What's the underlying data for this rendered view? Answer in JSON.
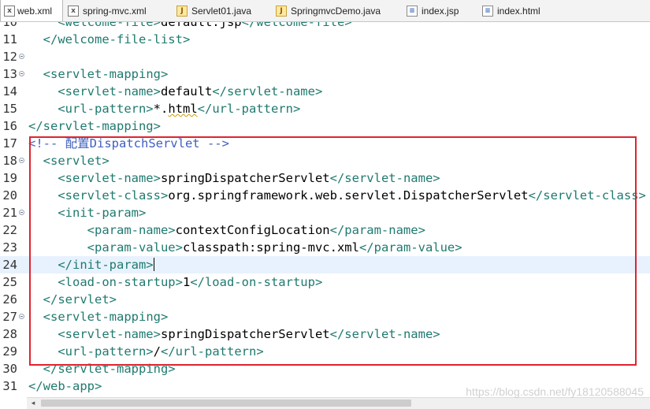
{
  "tabs": [
    {
      "label": "web.xml",
      "icon": "xml-file-icon",
      "active": true
    },
    {
      "label": "spring-mvc.xml",
      "icon": "xml-file-icon",
      "active": false
    },
    {
      "label": "Servlet01.java",
      "icon": "java-file-icon",
      "active": false
    },
    {
      "label": "SpringmvcDemo.java",
      "icon": "java-file-icon",
      "active": false
    },
    {
      "label": "index.jsp",
      "icon": "jsp-file-icon",
      "active": false
    },
    {
      "label": "index.html",
      "icon": "html-file-icon",
      "active": false
    }
  ],
  "editor": {
    "lines": [
      {
        "num": "10",
        "fold": false,
        "code": "    <welcome-file>default.jsp</welcome-file>"
      },
      {
        "num": "11",
        "fold": false,
        "code": "  </welcome-file-list>"
      },
      {
        "num": "12",
        "fold": true,
        "code": ""
      },
      {
        "num": "13",
        "fold": true,
        "code": "  <servlet-mapping>"
      },
      {
        "num": "14",
        "fold": false,
        "code": "    <servlet-name>default</servlet-name>"
      },
      {
        "num": "15",
        "fold": false,
        "code": "    <url-pattern>*.html</url-pattern>"
      },
      {
        "num": "16",
        "fold": false,
        "code": "</servlet-mapping>"
      },
      {
        "num": "17",
        "fold": false,
        "code": "<!-- 配置DispatchServlet -->"
      },
      {
        "num": "18",
        "fold": true,
        "code": "  <servlet>"
      },
      {
        "num": "19",
        "fold": false,
        "code": "    <servlet-name>springDispatcherServlet</servlet-name>"
      },
      {
        "num": "20",
        "fold": false,
        "code": "    <servlet-class>org.springframework.web.servlet.DispatcherServlet</servlet-class>"
      },
      {
        "num": "21",
        "fold": true,
        "code": "    <init-param>"
      },
      {
        "num": "22",
        "fold": false,
        "code": "        <param-name>contextConfigLocation</param-name>"
      },
      {
        "num": "23",
        "fold": false,
        "code": "        <param-value>classpath:spring-mvc.xml</param-value>"
      },
      {
        "num": "24",
        "fold": false,
        "code": "    </init-param>",
        "current": true
      },
      {
        "num": "25",
        "fold": false,
        "code": "    <load-on-startup>1</load-on-startup>"
      },
      {
        "num": "26",
        "fold": false,
        "code": "  </servlet>"
      },
      {
        "num": "27",
        "fold": true,
        "code": "  <servlet-mapping>"
      },
      {
        "num": "28",
        "fold": false,
        "code": "    <servlet-name>springDispatcherServlet</servlet-name>"
      },
      {
        "num": "29",
        "fold": false,
        "code": "    <url-pattern>/</url-pattern>"
      },
      {
        "num": "30",
        "fold": false,
        "code": "  </servlet-mapping>"
      },
      {
        "num": "31",
        "fold": false,
        "code": "</web-app>"
      }
    ]
  },
  "watermark": "https://blog.csdn.net/fy18120588045",
  "colors": {
    "tag": "#1f7a6f",
    "text": "#000000",
    "comment": "#3f5fbf",
    "highlight_box": "#e0232f",
    "current_line": "#e8f2fe"
  }
}
